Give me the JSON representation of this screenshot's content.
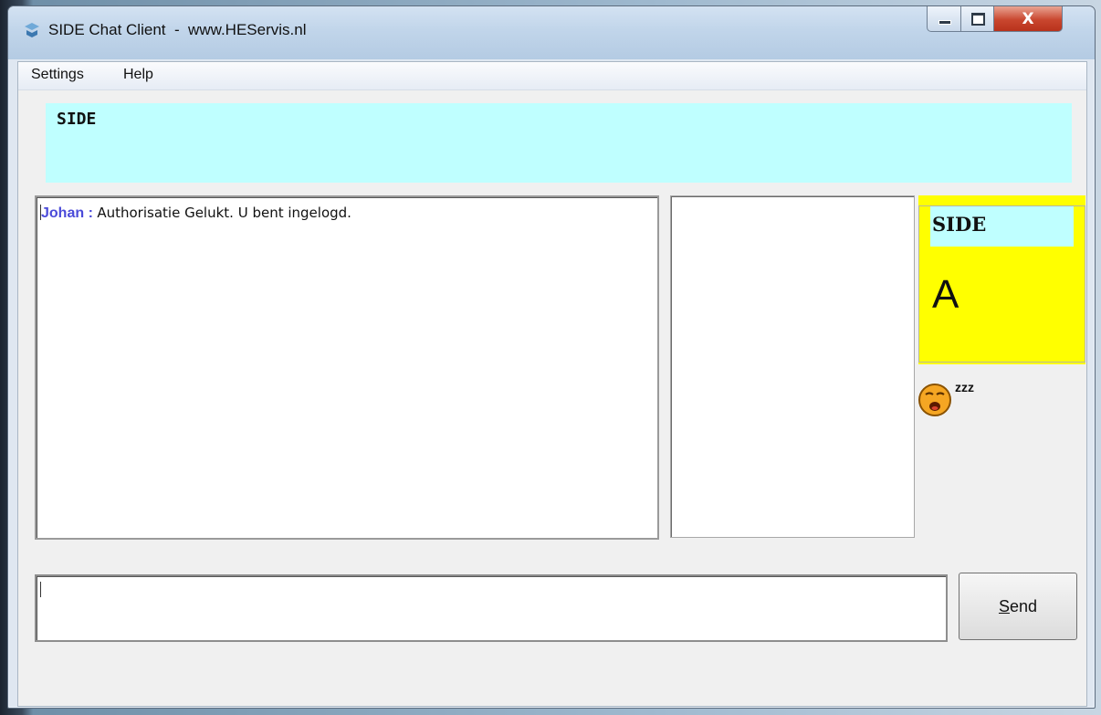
{
  "window": {
    "title": "SIDE Chat Client  -  www.HEServis.nl",
    "controls": {
      "minimize_icon": "minimize-icon",
      "maximize_icon": "maximize-icon",
      "close_label": "X"
    }
  },
  "menu": {
    "items": [
      {
        "label": "Settings"
      },
      {
        "label": "Help"
      }
    ]
  },
  "header": {
    "title": "SIDE",
    "background": "#bfffff"
  },
  "chat": {
    "messages": [
      {
        "user": "Johan",
        "separator": " : ",
        "text": "Authorisatie Gelukt. U bent ingelogd."
      }
    ],
    "user_color": "#4b4bd9"
  },
  "users": {
    "items": []
  },
  "status_card": {
    "name": "SIDE",
    "letter": "A",
    "background": "#ffff00",
    "status_icon": "sleeping-face-icon",
    "status_text": "zzz"
  },
  "composer": {
    "value": "",
    "send_label_first": "S",
    "send_label_rest": "end"
  }
}
